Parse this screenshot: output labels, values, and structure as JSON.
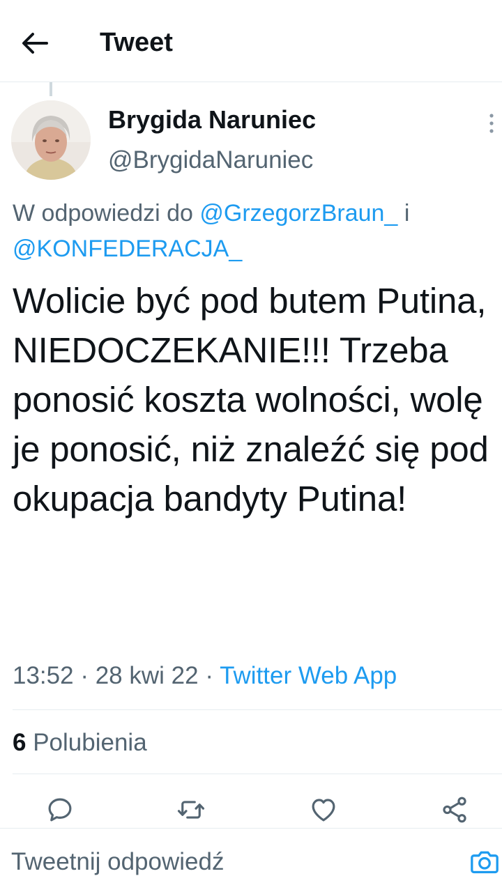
{
  "header": {
    "back_icon": "arrow-left-icon",
    "title": "Tweet"
  },
  "author": {
    "name": "Brygida Naruniec",
    "handle": "@BrygidaNaruniec",
    "more_icon": "more-vertical-icon"
  },
  "reply_to": {
    "prefix": "W odpowiedzi do",
    "mention_1": "@GrzegorzBraun_",
    "connector": "i",
    "mention_2": "@KONFEDERACJA_"
  },
  "tweet": {
    "text": "Wolicie być pod butem Putina, NIEDOCZEKANIE!!! Trzeba ponosić koszta wolności, wolę je ponosić, niż znaleźć się pod okupacja bandyty Putina!"
  },
  "meta": {
    "time": "13:52",
    "separator": "·",
    "date": "28 kwi 22",
    "source": "Twitter Web App"
  },
  "likes": {
    "count": "6",
    "label": "Polubienia"
  },
  "actions": {
    "reply_icon": "reply-icon",
    "retweet_icon": "retweet-icon",
    "like_icon": "heart-icon",
    "share_icon": "share-icon"
  },
  "reply_bar": {
    "placeholder": "Tweetnij odpowiedź",
    "camera_icon": "camera-icon"
  },
  "colors": {
    "accent": "#1d9bf0",
    "text_primary": "#0f1419",
    "text_secondary": "#536471",
    "divider": "#e6ecf0"
  }
}
